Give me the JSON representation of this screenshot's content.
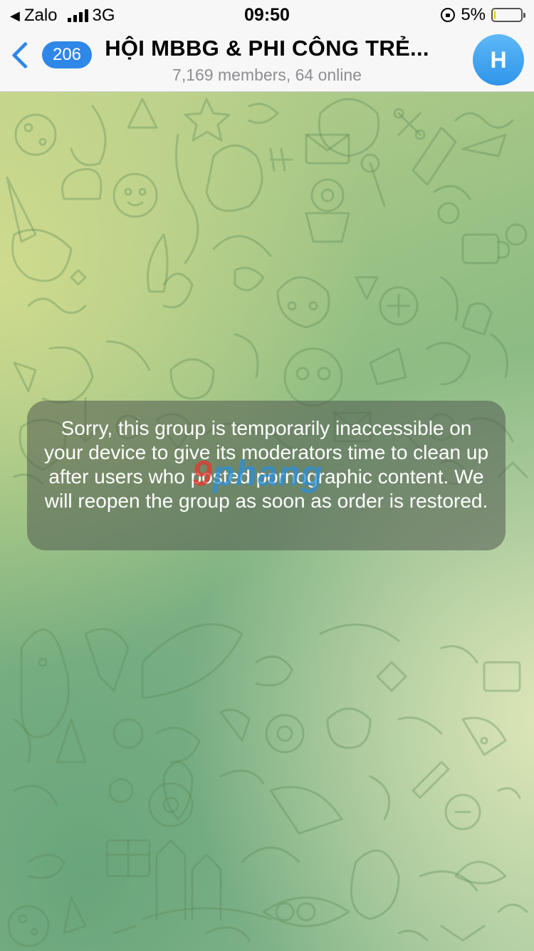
{
  "status_bar": {
    "back_app": "Zalo",
    "network": "3G",
    "time": "09:50",
    "battery_percent_label": "5%",
    "battery_level": 0.05
  },
  "header": {
    "unread_count": "206",
    "title": "HỘI MBBG & PHI CÔNG TRẺ...",
    "subtitle": "7,169 members, 64 online",
    "avatar_initial": "H",
    "accent_color": "#2f87e8"
  },
  "notice": {
    "message": "Sorry, this group is temporarily inaccessible on your device to give its moderators time to clean up after users who posted pornographic content. We will reopen the group as soon as order is restored."
  },
  "watermark": {
    "part_a": "9",
    "part_b": "phang"
  }
}
